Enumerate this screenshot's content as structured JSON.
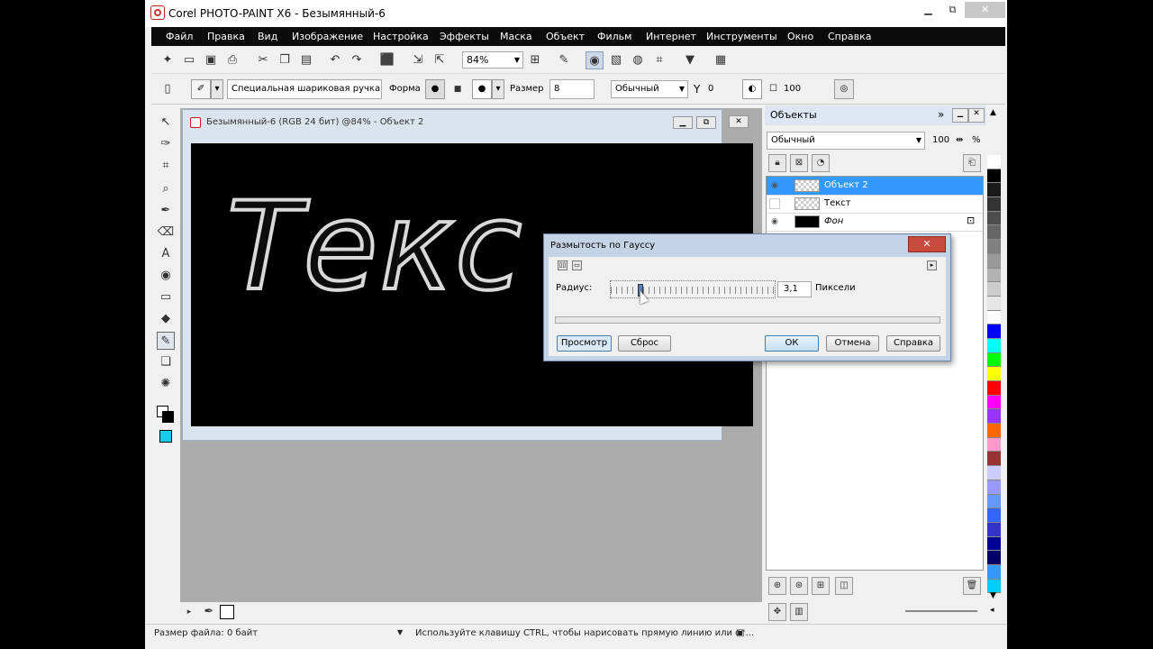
{
  "app": {
    "title": "Corel PHOTO-PAINT X6 - Безымянный-6",
    "controls": [
      "▁",
      "⧉",
      "✕"
    ]
  },
  "menu": [
    "Файл",
    "Правка",
    "Вид",
    "Изображение",
    "Настройка",
    "Эффекты",
    "Маска",
    "Объект",
    "Фильм",
    "Интернет",
    "Инструменты",
    "Окно",
    "Справка"
  ],
  "toolbar": {
    "zoom": "84%"
  },
  "property_bar": {
    "brush": "Специальная шариковая ручка",
    "shape_label": "Форма",
    "size_label": "Размер",
    "size_value": "8",
    "blend_mode": "Обычный",
    "transparency": "0",
    "opacity": "100"
  },
  "document": {
    "title": "Безымянный-6 (RGB 24 бит) @84% - Объект 2",
    "canvas_text": "Текс"
  },
  "objects_panel": {
    "title": "Объекты",
    "merge_mode": "Обычный",
    "opacity": "100",
    "percent": "%",
    "layers": [
      {
        "name": "Объект 2",
        "selected": true
      },
      {
        "name": "Текст",
        "selected": false
      },
      {
        "name": "Фон",
        "selected": false
      }
    ]
  },
  "dialog": {
    "title": "Размытость по Гауссу",
    "radius_label": "Радиус:",
    "radius_value": "3,1",
    "unit": "Пиксели",
    "radius_slider_fraction": 0.17,
    "buttons": {
      "preview": "Просмотр",
      "reset": "Сброс",
      "ok": "ОК",
      "cancel": "Отмена",
      "help": "Справка"
    }
  },
  "status": {
    "file_size": "Размер файла: 0 байт",
    "hint": "Используйте клавишу CTRL, чтобы нарисовать прямую линию или ог..."
  },
  "palette": [
    "#ffffff",
    "#000000",
    "#1a1a1a",
    "#333333",
    "#4d4d4d",
    "#666666",
    "#808080",
    "#999999",
    "#b3b3b3",
    "#cccccc",
    "#e6e6e6",
    "#ffffff",
    "#0000ff",
    "#00ffff",
    "#00ff00",
    "#ffff00",
    "#ff0000",
    "#ff00ff",
    "#9933ff",
    "#ff6600",
    "#ff99cc",
    "#993333",
    "#ccccff",
    "#9999ff",
    "#6699ff",
    "#3366ff",
    "#3333cc",
    "#000099",
    "#000066",
    "#3399ff",
    "#00ccff"
  ]
}
